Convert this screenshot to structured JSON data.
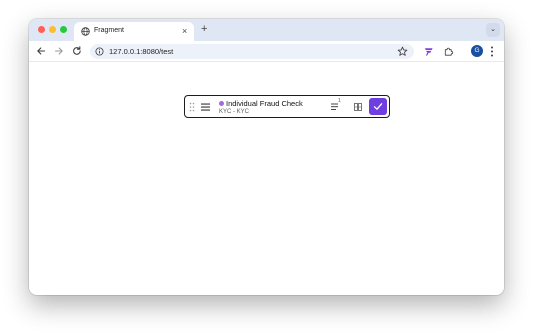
{
  "browser": {
    "tab": {
      "title": "Fragment",
      "favicon": "globe-icon",
      "close_glyph": "×"
    },
    "new_tab_glyph": "+",
    "tab_menu_glyph": "⌄",
    "url": "127.0.0.1:8080/test",
    "profile_initial": "G",
    "colors": {
      "tab_strip": "#dfe6f4",
      "omnibox": "#edf1f9",
      "profile": "#1a4fa0"
    }
  },
  "card": {
    "title": "Individual Fraud Check",
    "subtitle": "KYC - KYC",
    "status_dot_color": "#a66bd8",
    "list_count": "1",
    "confirm_color": "#6e3ee0",
    "icons": [
      "drag-handle-icon",
      "menu-icon",
      "list-icon",
      "grid-icon",
      "check-icon"
    ]
  }
}
